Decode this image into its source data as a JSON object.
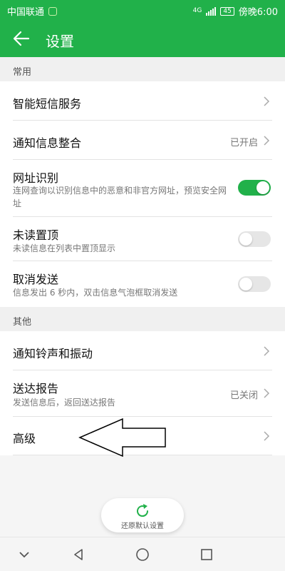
{
  "statusbar": {
    "carrier": "中国联通",
    "network": "4G",
    "battery": "45",
    "time": "傍晚6:00"
  },
  "appbar": {
    "title": "设置"
  },
  "sections": {
    "common": "常用",
    "other": "其他"
  },
  "rows": {
    "smart_sms": {
      "label": "智能短信服务"
    },
    "notification_merge": {
      "label": "通知信息整合",
      "value": "已开启"
    },
    "url_recognition": {
      "label": "网址识别",
      "sub": "连网查询以识别信息中的恶意和非官方网址，预览安全网址",
      "enabled": true
    },
    "unread_pin": {
      "label": "未读置顶",
      "sub": "未读信息在列表中置顶显示",
      "enabled": false
    },
    "cancel_send": {
      "label": "取消发送",
      "sub": "信息发出 6 秒内，双击信息气泡框取消发送",
      "enabled": false
    },
    "ringtone_vibration": {
      "label": "通知铃声和振动"
    },
    "delivery_report": {
      "label": "送达报告",
      "sub": "发送信息后，返回送达报告",
      "value": "已关闭"
    },
    "advanced": {
      "label": "高级"
    }
  },
  "restore": {
    "label": "还原默认设置"
  },
  "colors": {
    "accent": "#21b14a"
  },
  "icons": [
    "back-arrow-icon",
    "chevron-right-icon",
    "refresh-icon",
    "nav-back-icon",
    "nav-home-icon",
    "nav-recents-icon",
    "nav-dropdown-icon"
  ]
}
